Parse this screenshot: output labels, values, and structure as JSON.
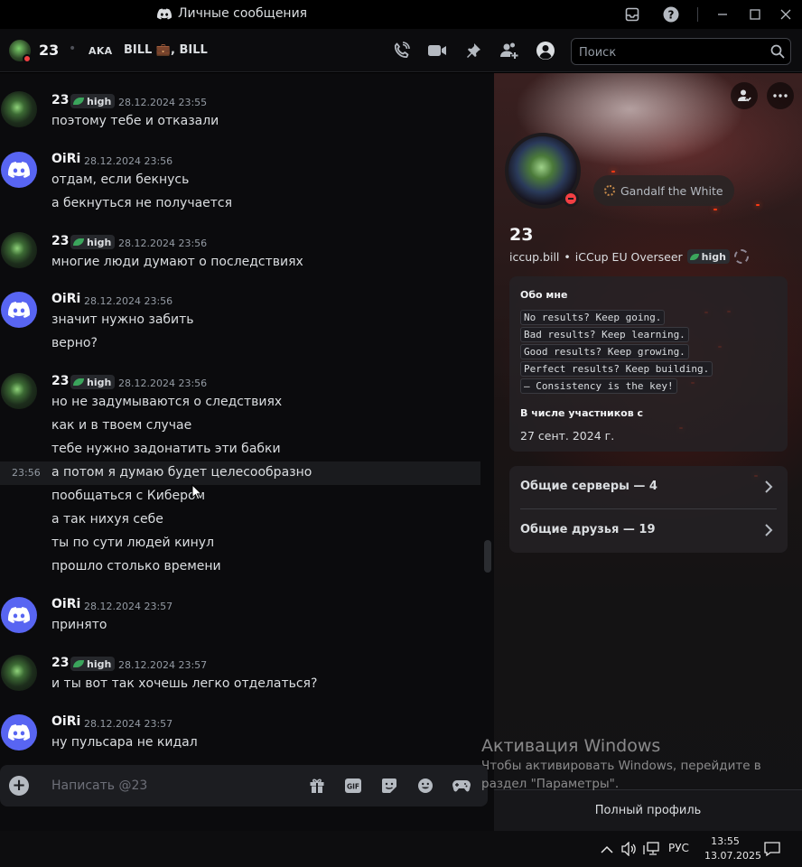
{
  "window": {
    "title": "Личные сообщения",
    "controls": [
      "inbox-icon",
      "help-icon",
      "minimize-icon",
      "maximize-icon",
      "close-icon"
    ]
  },
  "header": {
    "name": "23",
    "separator": "•",
    "aka_label": "AKA",
    "aliases": "BILL 💼, BILL",
    "search_placeholder": "Поиск",
    "icons": [
      "voice-call-icon",
      "video-call-icon",
      "pinned-icon",
      "add-friends-icon",
      "user-profile-icon"
    ]
  },
  "badge": {
    "label": "high"
  },
  "messages": [
    {
      "author": "23",
      "time": "28.12.2024 23:55",
      "has_badge": true,
      "lines": [
        "поэтому тебе и отказали"
      ]
    },
    {
      "author": "OiRi",
      "time": "28.12.2024 23:56",
      "has_badge": false,
      "lines": [
        "отдам, если бекнусь",
        "а бекнуться не получается"
      ]
    },
    {
      "author": "23",
      "time": "28.12.2024 23:56",
      "has_badge": true,
      "lines": [
        "многие люди думают о последствиях"
      ]
    },
    {
      "author": "OiRi",
      "time": "28.12.2024 23:56",
      "has_badge": false,
      "lines": [
        "значит нужно забить",
        "верно?"
      ]
    },
    {
      "author": "23",
      "time": "28.12.2024 23:56",
      "has_badge": true,
      "lines": [
        "но не задумываются о следствиях",
        "как и в твоем случае",
        "тебе нужно задонатить эти бабки",
        "а потом я думаю будет целесообразно",
        "пообщаться с Кибером",
        "а так нихуя себе",
        "ты по сути людей кинул",
        "прошло столько времени"
      ]
    },
    {
      "author": "OiRi",
      "time": "28.12.2024 23:57",
      "has_badge": false,
      "lines": [
        "принято"
      ]
    },
    {
      "author": "23",
      "time": "28.12.2024 23:57",
      "has_badge": true,
      "lines": [
        "и ты вот так хочешь легко отделаться?"
      ]
    },
    {
      "author": "OiRi",
      "time": "28.12.2024 23:57",
      "has_badge": false,
      "lines": [
        "ну пульсара не кидал"
      ]
    }
  ],
  "hover_time": "23:56",
  "composer": {
    "placeholder": "Написать @23",
    "icons": [
      "gift-icon",
      "gif-icon",
      "sticker-icon",
      "emoji-icon",
      "activity-icon"
    ]
  },
  "profile": {
    "name": "23",
    "username": "iccup.bill",
    "bullet": "•",
    "pronouns": "iCCup EU Overseer",
    "badge_label": "high",
    "custom_status": "Gandalf the White",
    "about_heading": "Обо мне",
    "about_lines": [
      "No results? Keep going.",
      "Bad results? Keep learning.",
      "Good results? Keep growing.",
      "Perfect results? Keep building.",
      "— Consistency is the key!"
    ],
    "member_since_heading": "В числе участников с",
    "member_since": "27 сент. 2024 г.",
    "mutual_servers": "Общие серверы — 4",
    "mutual_friends": "Общие друзья — 19",
    "full_profile": "Полный профиль"
  },
  "watermark": {
    "title": "Активация Windows",
    "subtitle": "Чтобы активировать Windows, перейдите в раздел \"Параметры\"."
  },
  "taskbar": {
    "language": "РУС",
    "time": "13:55",
    "date": "13.07.2025"
  }
}
